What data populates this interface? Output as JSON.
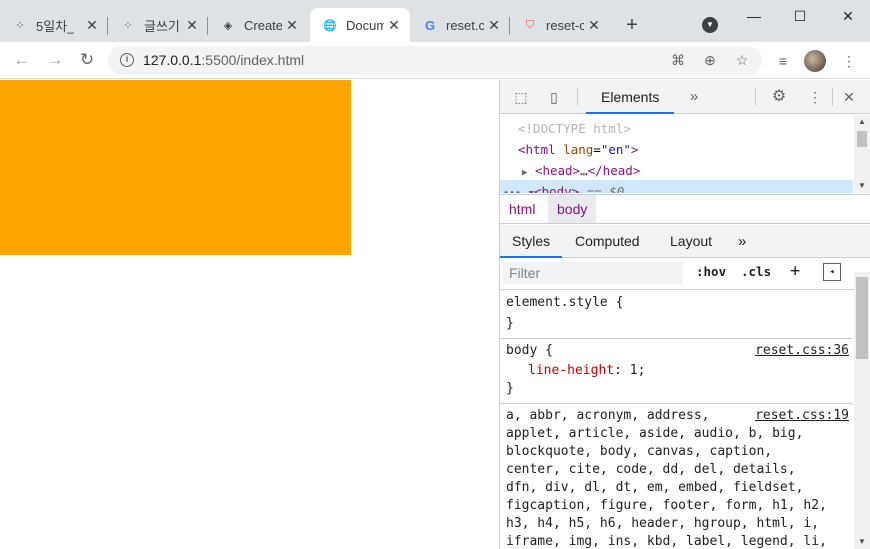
{
  "tabs": [
    {
      "title": "5일차_",
      "icon": "tistory-icon"
    },
    {
      "title": "글쓰기",
      "icon": "tistory-icon"
    },
    {
      "title": "Create",
      "icon": "codepen-icon"
    },
    {
      "title": "Docum",
      "icon": "globe-icon"
    },
    {
      "title": "reset.c",
      "icon": "google-icon"
    },
    {
      "title": "reset-c",
      "icon": "brave-icon"
    }
  ],
  "address": {
    "host": "127.0.0.1",
    "path": ":5500/index.html"
  },
  "page": {
    "box_color": "#ffa500"
  },
  "devtools": {
    "main_tab": "Elements",
    "dom": {
      "doctype": "<!DOCTYPE html>",
      "html_open": "<html",
      "lang_attr": "lang",
      "lang_val": "\"en\"",
      "html_close": ">",
      "head": "<head>…</head>",
      "body": "<body>",
      "eq": "== $0"
    },
    "breadcrumbs": [
      "html",
      "body"
    ],
    "style_tabs": [
      "Styles",
      "Computed",
      "Layout"
    ],
    "filter_placeholder": "Filter",
    "hov": ":hov",
    "cls": ".cls",
    "rules": {
      "element_style": "element.style {",
      "close": "}",
      "body_selector": "body {",
      "body_source": "reset.css:36",
      "body_prop": "line-height",
      "body_value": ": 1;",
      "reset_source": "reset.css:19",
      "reset_lines": [
        "a, abbr, acronym, address,",
        "applet, article, aside, audio, b, big,",
        "blockquote, body, canvas, caption,",
        "center, cite, code, dd, del, details,",
        "dfn, div, dl, dt, em, embed, fieldset,",
        "figcaption, figure, footer, form, h1, h2,",
        "h3, h4, h5, h6, header, hgroup, html, i,",
        "iframe, img, ins, kbd, label, legend, li,"
      ]
    }
  }
}
